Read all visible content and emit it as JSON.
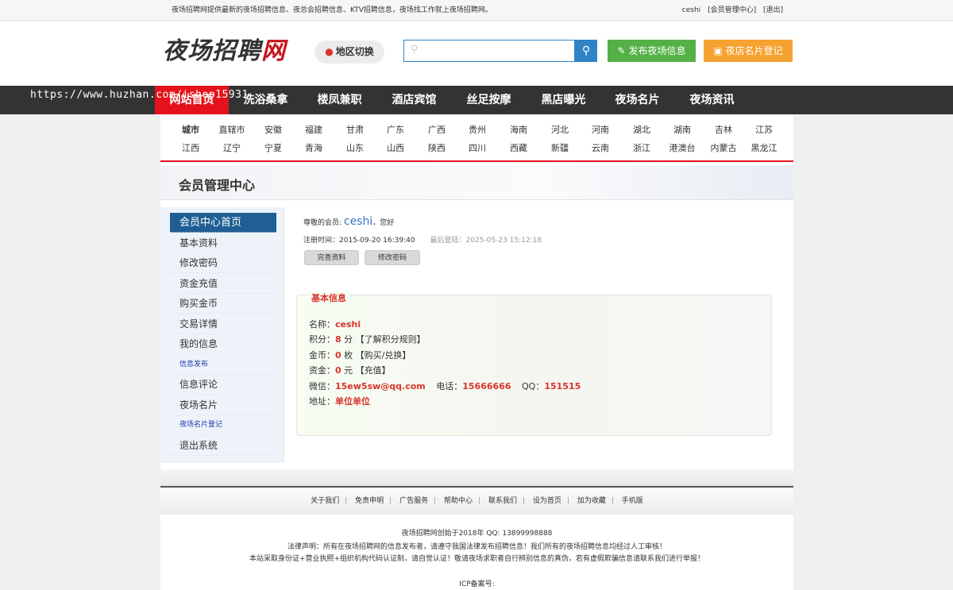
{
  "topbar": {
    "slogan": "夜场招聘网提供最新的夜场招聘信息、夜总会招聘信息、KTV招聘信息，夜场找工作就上夜场招聘网。",
    "user": "ceshi",
    "member_center": "[会员管理中心]",
    "logout": "[退出]"
  },
  "header": {
    "logo_main": "夜场招聘",
    "logo_suffix": "网",
    "region_label": "地区切换",
    "search_placeholder": "",
    "post_label": "发布夜场信息",
    "card_label": "夜店名片登记"
  },
  "nav": {
    "items": [
      "网站首页",
      "洗浴桑拿",
      "楼凤兼职",
      "酒店宾馆",
      "丝足按摩",
      "黑店曝光",
      "夜场名片",
      "夜场资讯"
    ]
  },
  "watermark": "https://www.huzhan.com/ishop15931",
  "cities": {
    "row1": [
      "城市",
      "直辖市",
      "安徽",
      "福建",
      "甘肃",
      "广东",
      "广西",
      "贵州",
      "海南",
      "河北",
      "河南",
      "湖北",
      "湖南",
      "吉林",
      "江苏"
    ],
    "row2": [
      "江西",
      "辽宁",
      "宁夏",
      "青海",
      "山东",
      "山西",
      "陕西",
      "四川",
      "西藏",
      "新疆",
      "云南",
      "浙江",
      "港澳台",
      "内蒙古",
      "黑龙江"
    ]
  },
  "member": {
    "title": "会员管理中心"
  },
  "sidebar": {
    "items": [
      "会员中心首页",
      "基本资料",
      "修改密码",
      "资金充值",
      "购买金币",
      "交易详情",
      "我的信息",
      "信息发布",
      "信息评论",
      "夜场名片",
      "夜场名片登记",
      "退出系统"
    ]
  },
  "welcome": {
    "prefix": "尊敬的会员:",
    "name": "ceshi",
    "suffix": "，您好",
    "reg_label": "注册时间：",
    "reg_time": "2015-09-20 16:39:40",
    "last_login_label": "最后登陆：",
    "last_login": "2025-05-23 15:12:18",
    "btn_profile": "完善资料",
    "btn_password": "修改密码"
  },
  "info": {
    "legend": "基本信息",
    "name_label": "名称：",
    "name_value": "ceshi",
    "points_label": "积分：",
    "points_value": "8",
    "points_unit": "分",
    "points_link": "【了解积分规则】",
    "coins_label": "金币：",
    "coins_value": "0",
    "coins_unit": "枚",
    "coins_link": "【购买/兑换】",
    "funds_label": "资金：",
    "funds_value": "0",
    "funds_unit": "元",
    "funds_link": "【充值】",
    "wechat_label": "微信：",
    "wechat_value": "15ew5sw@qq.com",
    "phone_label": "电话：",
    "phone_value": "15666666",
    "qq_label": "QQ：",
    "qq_value": "151515",
    "address_label": "地址：",
    "address_value": "单位单位"
  },
  "footer": {
    "links": [
      "关于我们",
      "免责申明",
      "广告服务",
      "帮助中心",
      "联系我们",
      "设为首页",
      "加为收藏",
      "手机版"
    ],
    "line1": "夜场招聘网创始于2018年 QQ: 13899998888",
    "line2": "法律声明：所有在夜场招聘网的信息发布者，请遵守我国法律发布招聘信息！我们所有的夜场招聘信息均经过人工审核！",
    "line3": "本站采取身份证+营业执照+组织机构代码认证制，请自觉认证！敬请夜场求职者自行辨别信息的真伪，若有虚假欺骗信息请联系我们进行举报！",
    "line4": "ICP备案号:"
  },
  "colors": {
    "accent_red": "#e5121b",
    "nav_bg": "#333333",
    "search_blue": "#2e84c7",
    "post_green": "#55b047",
    "card_orange": "#f6a230",
    "sidebar_active": "#1f5f94"
  }
}
